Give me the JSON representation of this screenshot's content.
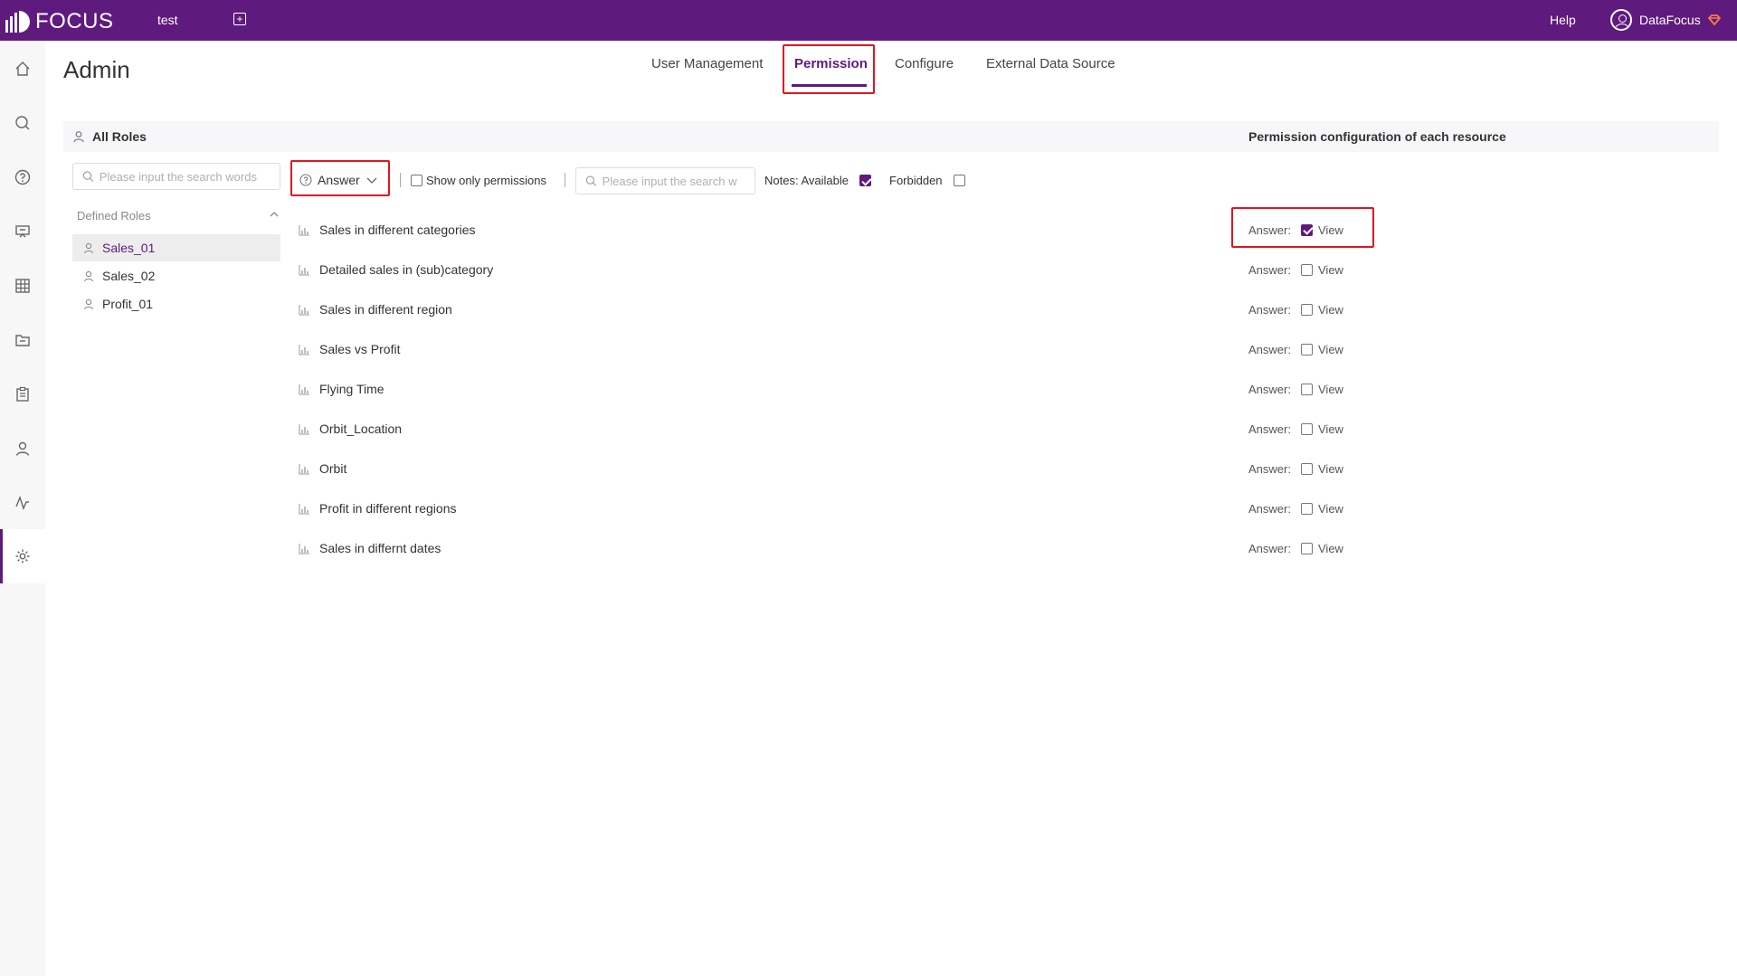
{
  "topbar": {
    "logo_text": "FOCUS",
    "tab_label": "test",
    "add_tab_symbol": "+",
    "help_label": "Help",
    "user_name": "DataFocus"
  },
  "sidebar": {
    "items": [
      {
        "icon": "home-icon"
      },
      {
        "icon": "search-icon"
      },
      {
        "icon": "question-icon"
      },
      {
        "icon": "presentation-icon"
      },
      {
        "icon": "table-icon"
      },
      {
        "icon": "folder-icon"
      },
      {
        "icon": "clipboard-icon"
      },
      {
        "icon": "user-icon"
      },
      {
        "icon": "pulse-icon"
      },
      {
        "icon": "gear-icon",
        "active": true
      }
    ]
  },
  "header": {
    "title": "Admin",
    "tabs": [
      {
        "label": "User Management"
      },
      {
        "label": "Permission",
        "active": true
      },
      {
        "label": "Configure"
      },
      {
        "label": "External Data Source"
      }
    ]
  },
  "roles_panel": {
    "heading": "All Roles",
    "search_placeholder": "Please input the search words",
    "group_label": "Defined Roles",
    "roles": [
      {
        "label": "Sales_01",
        "selected": true
      },
      {
        "label": "Sales_02"
      },
      {
        "label": "Profit_01"
      }
    ]
  },
  "toolbar": {
    "type_select_value": "Answer",
    "show_only_label": "Show only permissions",
    "search_placeholder": "Please input the search w",
    "notes_label": "Notes: Available",
    "forbidden_label": "Forbidden"
  },
  "permissions": {
    "heading": "Permission configuration of each resource",
    "answer_label": "Answer:",
    "view_label": "View",
    "resources": [
      {
        "name": "Sales in different categories",
        "view": true
      },
      {
        "name": "Detailed sales in (sub)category",
        "view": false
      },
      {
        "name": "Sales in different region",
        "view": false
      },
      {
        "name": "Sales vs Profit",
        "view": false
      },
      {
        "name": "Flying Time",
        "view": false
      },
      {
        "name": "Orbit_Location",
        "view": false
      },
      {
        "name": "Orbit",
        "view": false
      },
      {
        "name": "Profit in different regions",
        "view": false
      },
      {
        "name": "Sales in differnt dates",
        "view": false
      }
    ]
  },
  "colors": {
    "brand": "#5f1a7e",
    "highlight": "#e0161f"
  }
}
